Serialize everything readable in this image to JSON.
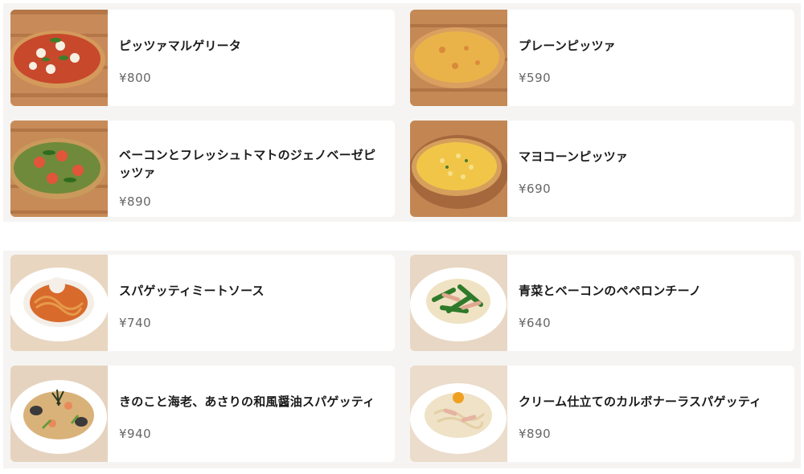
{
  "sections": [
    {
      "items": [
        {
          "name": "ピッツァマルゲリータ",
          "price": "¥800",
          "image": "pizza-margherita"
        },
        {
          "name": "プレーンピッツァ",
          "price": "¥590",
          "image": "pizza-plain"
        },
        {
          "name": "ベーコンとフレッシュトマトのジェノベーゼピッツァ",
          "price": "¥890",
          "image": "pizza-genovese"
        },
        {
          "name": "マヨコーンピッツァ",
          "price": "¥690",
          "image": "pizza-mayo-corn"
        }
      ]
    },
    {
      "items": [
        {
          "name": "スパゲッティミートソース",
          "price": "¥740",
          "image": "spaghetti-meat-sauce"
        },
        {
          "name": "青菜とベーコンのペペロンチーノ",
          "price": "¥640",
          "image": "peperoncino"
        },
        {
          "name": "きのこと海老、あさりの和風醤油スパゲッティ",
          "price": "¥940",
          "image": "wafu-spaghetti"
        },
        {
          "name": "クリーム仕立てのカルボナーラスパゲッティ",
          "price": "¥890",
          "image": "carbonara"
        }
      ]
    }
  ]
}
